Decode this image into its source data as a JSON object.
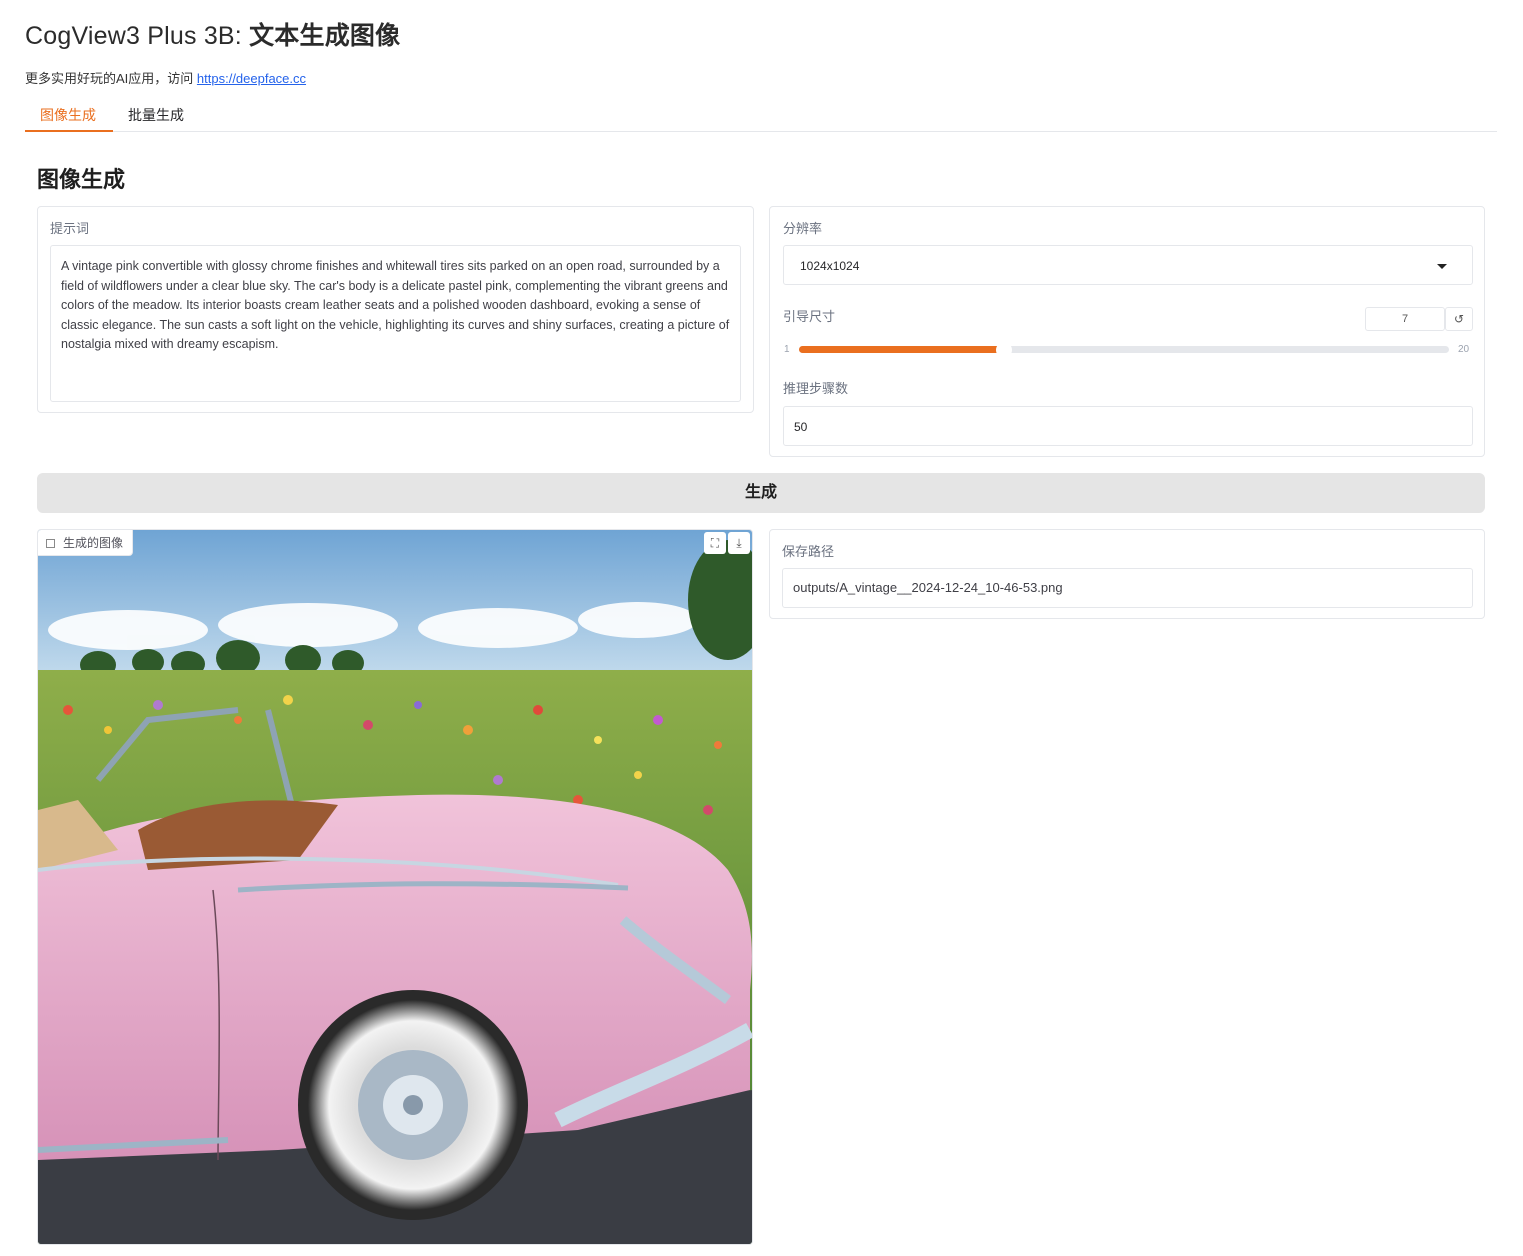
{
  "header": {
    "title_latin": "CogView3 Plus 3B:",
    "title_cjk": " 文本生成图像",
    "subtitle_text": "更多实用好玩的AI应用，访问 ",
    "subtitle_link": "https://deepface.cc"
  },
  "tabs": [
    {
      "label": "图像生成",
      "active": true
    },
    {
      "label": "批量生成",
      "active": false
    }
  ],
  "section_title": "图像生成",
  "prompt": {
    "label": "提示词",
    "value": "A vintage pink convertible with glossy chrome finishes and whitewall tires sits parked on an open road, surrounded by a field of wildflowers under a clear blue sky. The car's body is a delicate pastel pink, complementing the vibrant greens and colors of the meadow. Its interior boasts cream leather seats and a polished wooden dashboard, evoking a sense of classic elegance. The sun casts a soft light on the vehicle, highlighting its curves and shiny surfaces, creating a picture of nostalgia mixed with dreamy escapism."
  },
  "resolution": {
    "label": "分辨率",
    "value": "1024x1024"
  },
  "guidance": {
    "label": "引导尺寸",
    "value": "7",
    "min": "1",
    "max": "20",
    "reset_icon": "↺"
  },
  "steps": {
    "label": "推理步骤数",
    "value": "50"
  },
  "generate_button": "生成",
  "output_image": {
    "label": "生成的图像",
    "fullscreen_icon": "⛶",
    "download_icon": "⤓"
  },
  "save_path": {
    "label": "保存路径",
    "value": "outputs/A_vintage__2024-12-24_10-46-53.png"
  },
  "colors": {
    "accent": "#ea6f1f",
    "button_bg": "#e5e5e5",
    "car_pink": "#e8a9c9",
    "sky": "#8fbbe0"
  }
}
